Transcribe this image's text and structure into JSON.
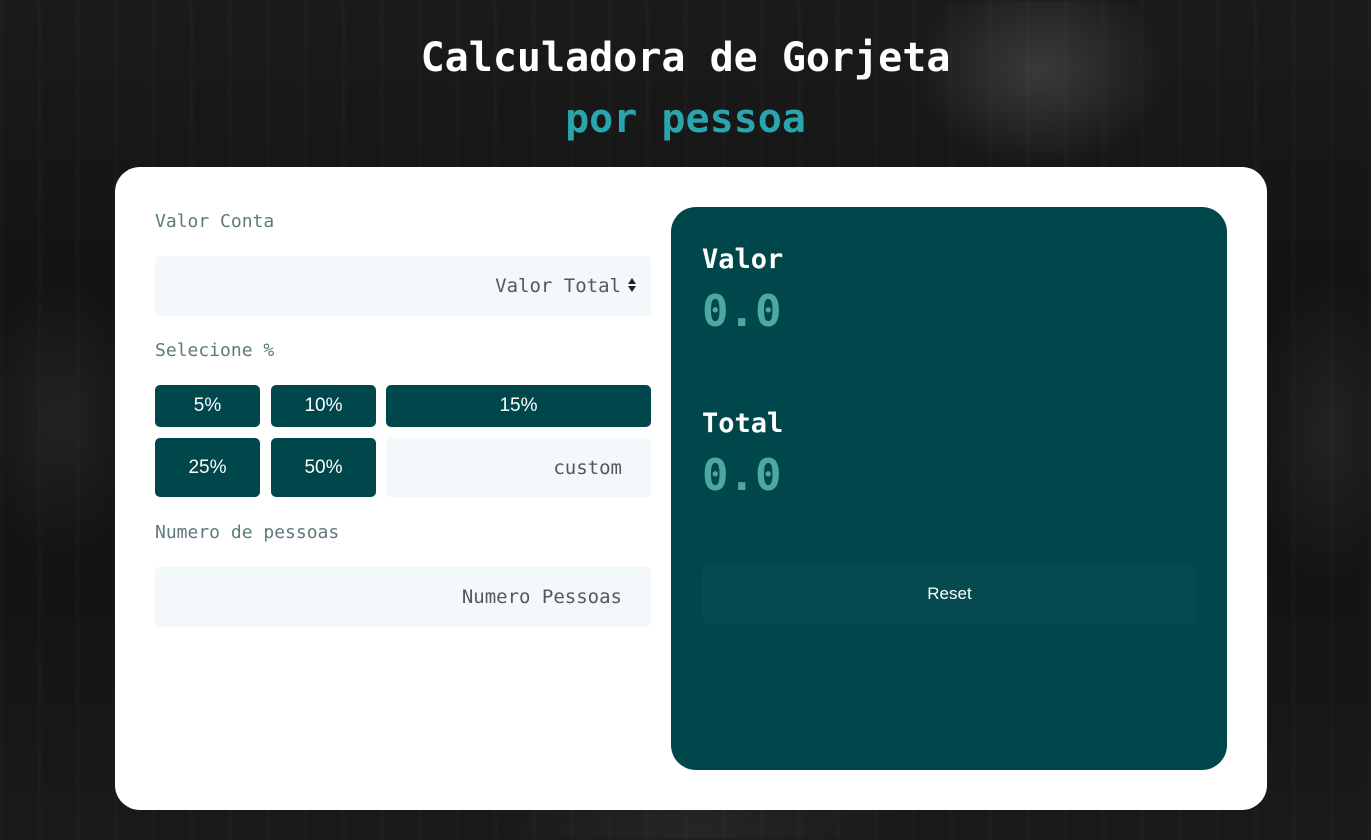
{
  "header": {
    "title": "Calculadora de Gorjeta",
    "subtitle": "por pessoa"
  },
  "form": {
    "bill_label": "Valor Conta",
    "bill_placeholder": "Valor Total",
    "bill_value": "",
    "tip_label": "Selecione %",
    "tip_options": [
      "5%",
      "10%",
      "15%",
      "25%",
      "50%"
    ],
    "custom_placeholder": "custom",
    "people_label": "Numero de pessoas",
    "people_placeholder": "Numero Pessoas"
  },
  "results": {
    "tip_label": "Valor",
    "tip_value": "0.0",
    "total_label": "Total",
    "total_value": "0.0",
    "reset_label": "Reset"
  },
  "colors": {
    "primary": "#00474b",
    "accent": "#28a5ad",
    "result_value": "#4fa8a0",
    "input_bg": "#f3f8fb"
  }
}
